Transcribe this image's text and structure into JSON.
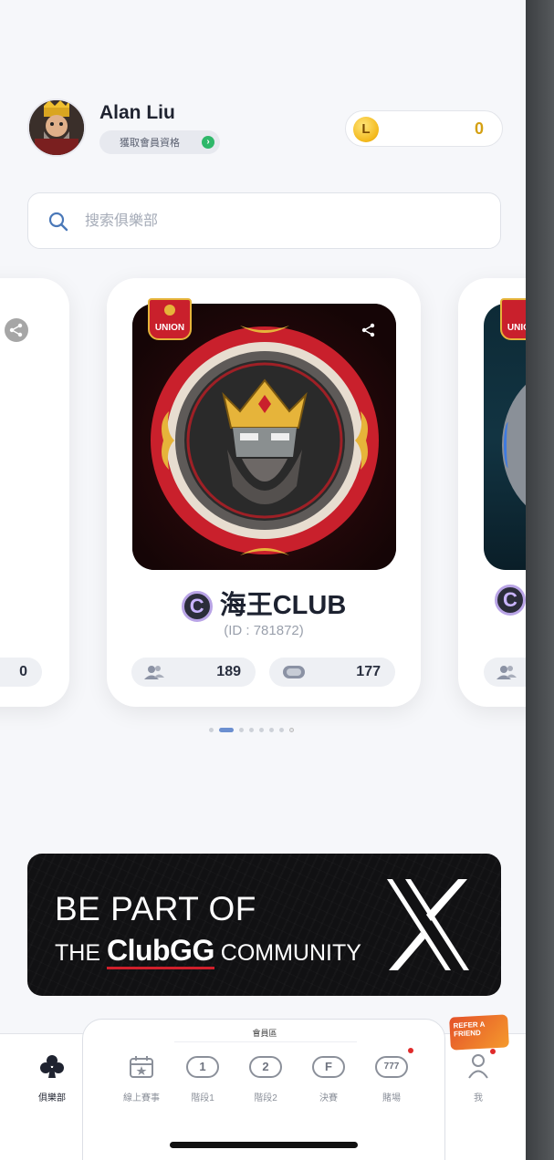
{
  "profile": {
    "name": "Alan Liu",
    "member_pill": "獲取會員資格"
  },
  "wallet": {
    "coin_symbol": "L",
    "balance": "0"
  },
  "search": {
    "placeholder": "搜索俱樂部"
  },
  "clubs": {
    "left": {
      "stat": "0"
    },
    "main": {
      "union_badge": "UNION",
      "name": "海王CLUB",
      "id_label": "(ID : 781872)",
      "members": "189",
      "tables": "177"
    },
    "right": {
      "union_badge": "UNION"
    },
    "badge_letter": "C"
  },
  "carousel": {
    "pages": 8,
    "active_index": 1
  },
  "banner": {
    "line1": "BE PART OF",
    "line2_pre": "THE",
    "line2_brand": "ClubGG",
    "line2_post": "COMMUNITY",
    "platform_icon": "x-logo"
  },
  "nav": {
    "member_area_title": "會員區",
    "items": [
      {
        "label": "俱樂部",
        "icon": "club-suit-icon"
      },
      {
        "label": "線上賽事",
        "icon": "calendar-star-icon"
      },
      {
        "label": "階段1",
        "icon": "stage-1-icon",
        "glyph": "1"
      },
      {
        "label": "階段2",
        "icon": "stage-2-icon",
        "glyph": "2"
      },
      {
        "label": "決賽",
        "icon": "final-icon",
        "glyph": "F"
      },
      {
        "label": "賭場",
        "icon": "slot-icon",
        "glyph": "777"
      },
      {
        "label": "我",
        "icon": "person-icon"
      }
    ],
    "refer": {
      "line1": "REFER A",
      "line2": "FRIEND"
    }
  },
  "colors": {
    "accent": "#6b8fd0",
    "coin": "#f3b81a",
    "banner_bg": "#111113",
    "club_red": "#c9202c"
  }
}
